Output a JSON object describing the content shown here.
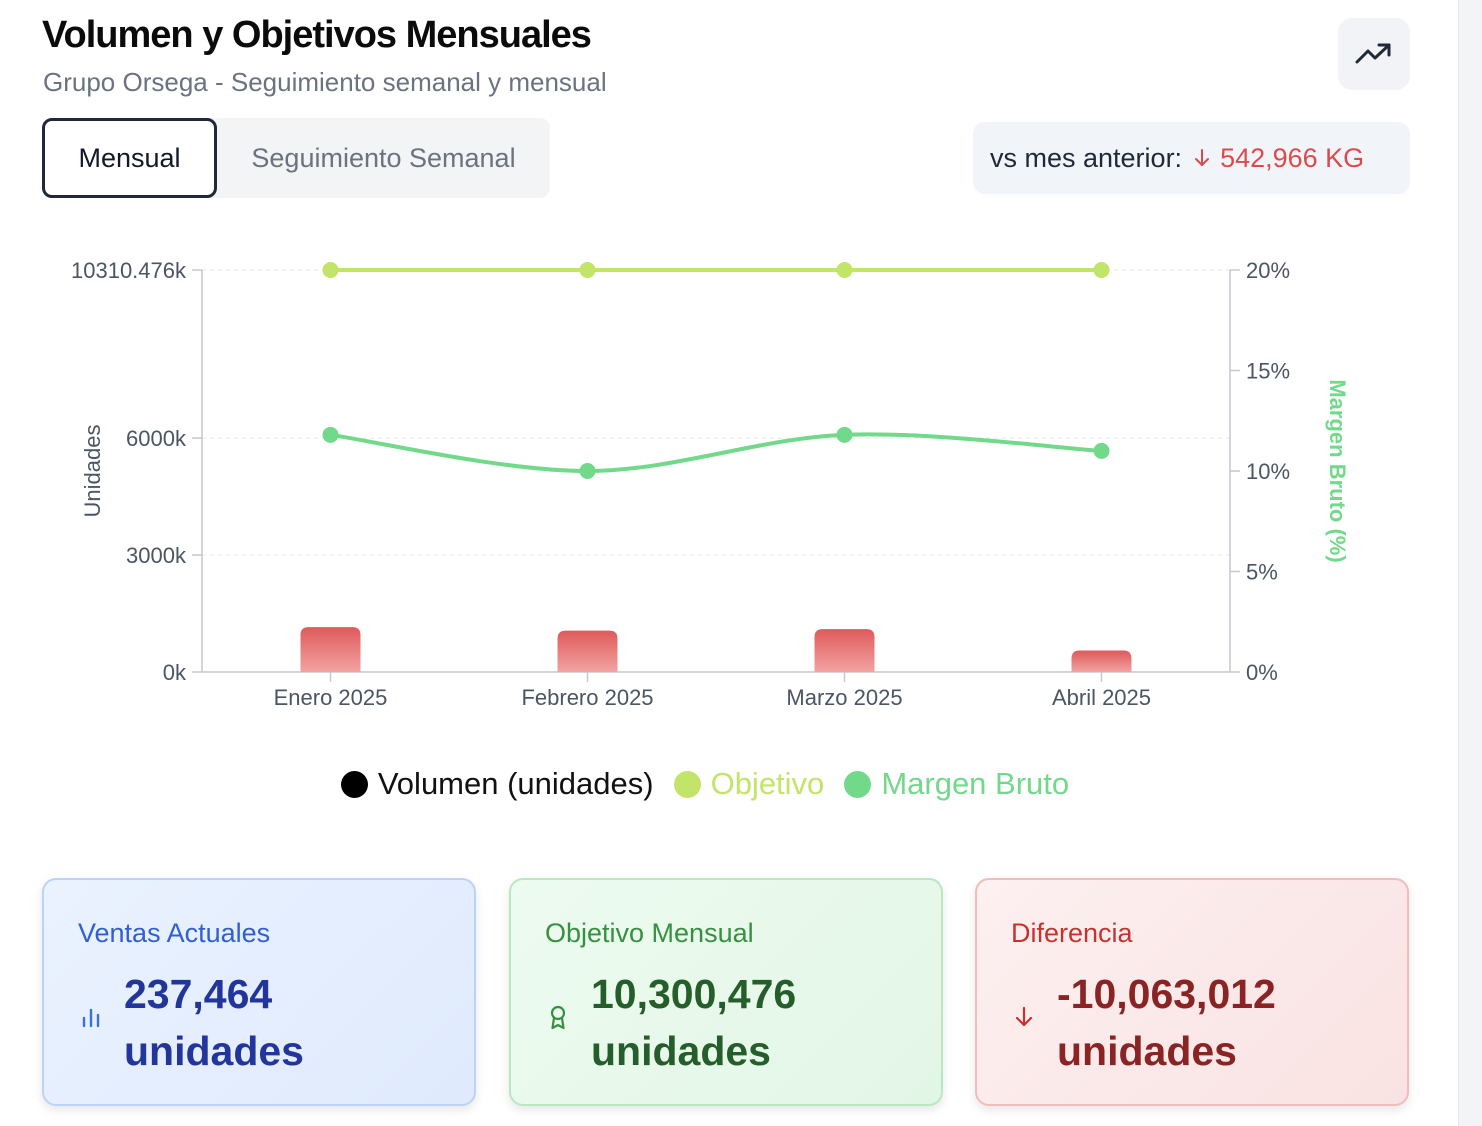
{
  "header": {
    "title": "Volumen y Objetivos Mensuales",
    "subtitle": "Grupo Orsega - Seguimiento semanal y mensual",
    "trend_button_icon": "trending-up-icon"
  },
  "tabs": [
    {
      "label": "Mensual",
      "active": true
    },
    {
      "label": "Seguimiento Semanal",
      "active": false
    }
  ],
  "comparison": {
    "label": "vs mes anterior:",
    "direction_icon": "arrow-down-icon",
    "value": "542,966 KG",
    "color": "#dc4b4b"
  },
  "chart_data": {
    "type": "bar",
    "categories": [
      "Enero 2025",
      "Febrero 2025",
      "Marzo 2025",
      "Abril 2025"
    ],
    "series": [
      {
        "name": "Volumen (unidades)",
        "type": "bar",
        "axis": "left",
        "values": [
          1150000,
          1060000,
          1100000,
          550000
        ],
        "color": "#e05c5c"
      },
      {
        "name": "Objetivo",
        "type": "line",
        "axis": "left",
        "values": [
          10310476,
          10310476,
          10310476,
          10310476
        ],
        "color": "#c2e468"
      },
      {
        "name": "Margen Bruto",
        "type": "line",
        "axis": "right",
        "values": [
          11.8,
          10.0,
          11.8,
          11.0
        ],
        "color": "#72d98a"
      }
    ],
    "left_axis": {
      "label": "Unidades",
      "ticks": [
        "0k",
        "3000k",
        "6000k",
        "10310.476k"
      ],
      "tick_values": [
        0,
        3000000,
        6000000,
        10310476
      ],
      "ylim": [
        0,
        10310476
      ]
    },
    "right_axis": {
      "label": "Margen Bruto (%)",
      "ticks": [
        "0%",
        "5%",
        "10%",
        "15%",
        "20%"
      ],
      "tick_values": [
        0,
        5,
        10,
        15,
        20
      ],
      "ylim": [
        0,
        20
      ]
    },
    "grid": true,
    "legend_position": "bottom"
  },
  "legend": [
    {
      "label": "Volumen (unidades)",
      "color": "#000000"
    },
    {
      "label": "Objetivo",
      "color": "#c2e468"
    },
    {
      "label": "Margen Bruto",
      "color": "#72d98a"
    }
  ],
  "cards": {
    "actual": {
      "label": "Ventas Actuales",
      "value": "237,464",
      "unit": "unidades",
      "icon": "bar-chart-icon"
    },
    "target": {
      "label": "Objetivo Mensual",
      "value": "10,300,476",
      "unit": "unidades",
      "icon": "award-icon"
    },
    "difference": {
      "label": "Diferencia",
      "value": "-10,063,012",
      "unit": "unidades",
      "icon": "arrow-down-icon"
    }
  }
}
